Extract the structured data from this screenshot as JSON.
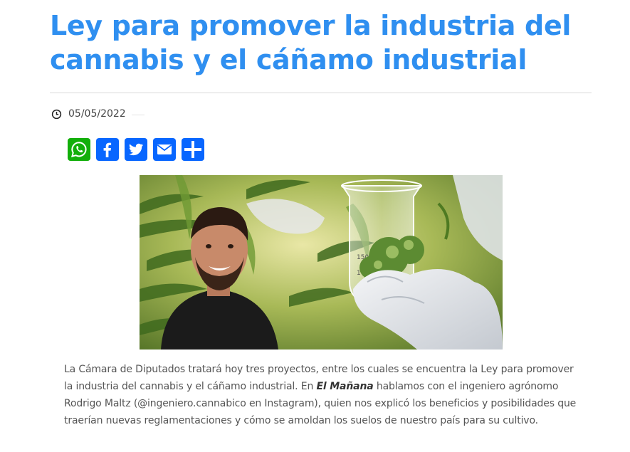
{
  "article": {
    "title": "Ley para promover la industria del cannabis y el cáñamo industrial",
    "date": "05/05/2022",
    "body": {
      "before": "La Cámara de Diputados tratará hoy tres proyectos, entre los cuales se encuentra la Ley para promover la industria del cannabis y el cáñamo industrial. En ",
      "emphasis": "El Mañana",
      "after": " hablamos con el ingeniero agrónomo Rodrigo Maltz (@ingeniero.cannabico en Instagram), quien nos explicó los beneficios y posibilidades que traerían nuevas reglamentaciones y cómo se amoldan los suelos de nuestro país para su cultivo."
    }
  },
  "share_buttons": [
    {
      "icon": "whatsapp-icon",
      "color": "#12af0a"
    },
    {
      "icon": "facebook-icon",
      "color": "#0866ff"
    },
    {
      "icon": "twitter-icon",
      "color": "#0866ff"
    },
    {
      "icon": "email-icon",
      "color": "#0866ff"
    },
    {
      "icon": "share-plus-icon",
      "color": "#0866ff"
    }
  ],
  "hero_image": {
    "beaker_markings": [
      "150",
      "100"
    ]
  },
  "colors": {
    "title": "#2f8ff0",
    "body_text": "#555555",
    "rule": "#d9d9d9"
  }
}
